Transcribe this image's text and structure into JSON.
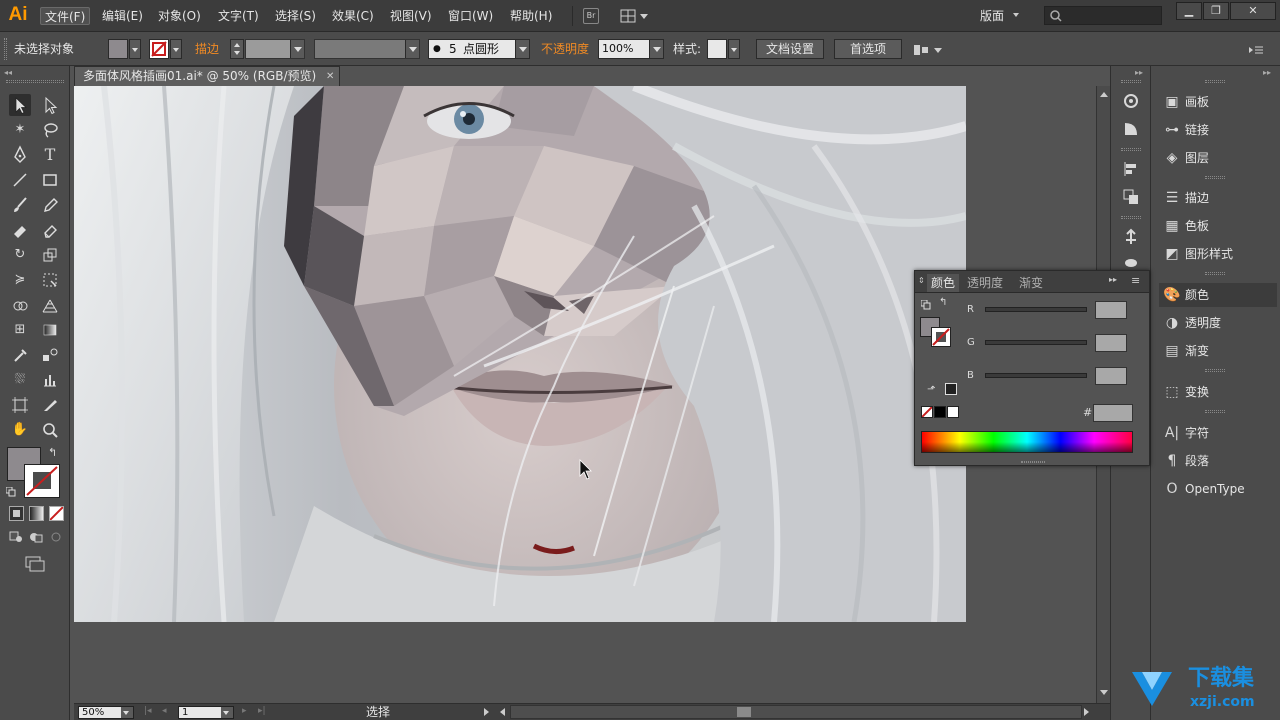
{
  "app": {
    "logo": "Ai",
    "workspace": "版面"
  },
  "menu": [
    "文件(F)",
    "编辑(E)",
    "对象(O)",
    "文字(T)",
    "选择(S)",
    "效果(C)",
    "视图(V)",
    "窗口(W)",
    "帮助(H)"
  ],
  "menu_extra": {
    "bridge": "Br"
  },
  "control": {
    "selection": "未选择对象",
    "stroke_label": "描边",
    "brush_dot": "●",
    "brush_size": "5",
    "brush_shape": "点圆形",
    "opacity_label": "不透明度",
    "opacity_value": "100%",
    "style_label": "样式:",
    "doc_setup": "文档设置",
    "preferences": "首选项"
  },
  "document": {
    "tab_title": "多面体风格插画01.ai* @ 50% (RGB/预览)",
    "close": "✕"
  },
  "status": {
    "zoom": "50%",
    "page": "1",
    "tool": "选择"
  },
  "color_panel": {
    "tabs": [
      "颜色",
      "透明度",
      "渐变"
    ],
    "channels": [
      "R",
      "G",
      "B"
    ],
    "hash": "#"
  },
  "right_panel": {
    "items": [
      "画板",
      "链接",
      "图层",
      "描边",
      "色板",
      "图形样式",
      "颜色",
      "透明度",
      "渐变",
      "变换",
      "字符",
      "段落",
      "OpenType"
    ],
    "icons": [
      "artboard-icon",
      "link-icon",
      "layers-icon",
      "stroke-icon",
      "swatches-icon",
      "graphic-styles-icon",
      "color-icon",
      "transparency-icon",
      "gradient-icon",
      "transform-icon",
      "character-icon",
      "paragraph-icon",
      "opentype-icon"
    ],
    "active": "颜色"
  },
  "watermark": {
    "text": "下载集",
    "url": "xzji.com"
  },
  "colors": {
    "accent_orange": "#ff9a00",
    "fill_gray": "#8e8a8e",
    "watermark_blue": "#1a8fe0"
  }
}
